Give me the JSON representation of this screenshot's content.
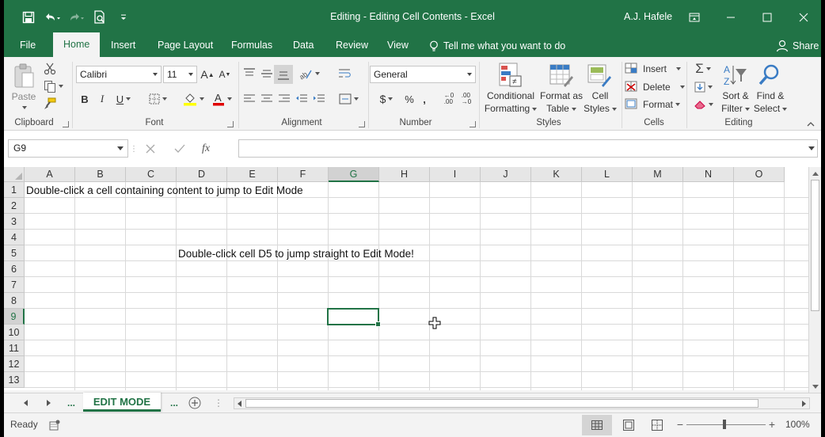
{
  "window": {
    "title": "Editing - Editing Cell Contents  -  Excel",
    "user": "A.J. Hafele"
  },
  "tabs": [
    "File",
    "Home",
    "Insert",
    "Page Layout",
    "Formulas",
    "Data",
    "Review",
    "View"
  ],
  "active_tab": "Home",
  "tell_me": "Tell me what you want to do",
  "share": "Share",
  "ribbon": {
    "clipboard": {
      "label": "Clipboard",
      "paste": "Paste"
    },
    "font": {
      "label": "Font",
      "name": "Calibri",
      "size": "11"
    },
    "alignment": {
      "label": "Alignment"
    },
    "number": {
      "label": "Number",
      "format": "General"
    },
    "styles": {
      "label": "Styles",
      "conditional_1": "Conditional",
      "conditional_2": "Formatting",
      "format_table_1": "Format as",
      "format_table_2": "Table",
      "cell_styles_1": "Cell",
      "cell_styles_2": "Styles"
    },
    "cells": {
      "label": "Cells",
      "insert": "Insert",
      "delete": "Delete",
      "format": "Format"
    },
    "editing": {
      "label": "Editing",
      "sort_1": "Sort &",
      "sort_2": "Filter",
      "find_1": "Find &",
      "find_2": "Select"
    }
  },
  "formula_bar": {
    "name_box": "G9",
    "fx": "fx",
    "value": ""
  },
  "grid": {
    "columns": [
      "A",
      "B",
      "C",
      "D",
      "E",
      "F",
      "G",
      "H",
      "I",
      "J",
      "K",
      "L",
      "M",
      "N",
      "O"
    ],
    "rows": [
      "1",
      "2",
      "3",
      "4",
      "5",
      "6",
      "7",
      "8",
      "9",
      "10",
      "11",
      "12",
      "13"
    ],
    "selected_column": "G",
    "selected_row": "9",
    "a1_text": "Double-click a cell containing content to jump to Edit Mode",
    "d5_text": "Double-click cell D5 to jump straight to Edit Mode!"
  },
  "sheets": {
    "active": "EDIT MODE",
    "more_left": "...",
    "more_right": "..."
  },
  "status": {
    "ready": "Ready",
    "zoom": "100%"
  },
  "colors": {
    "accent": "#217346"
  }
}
